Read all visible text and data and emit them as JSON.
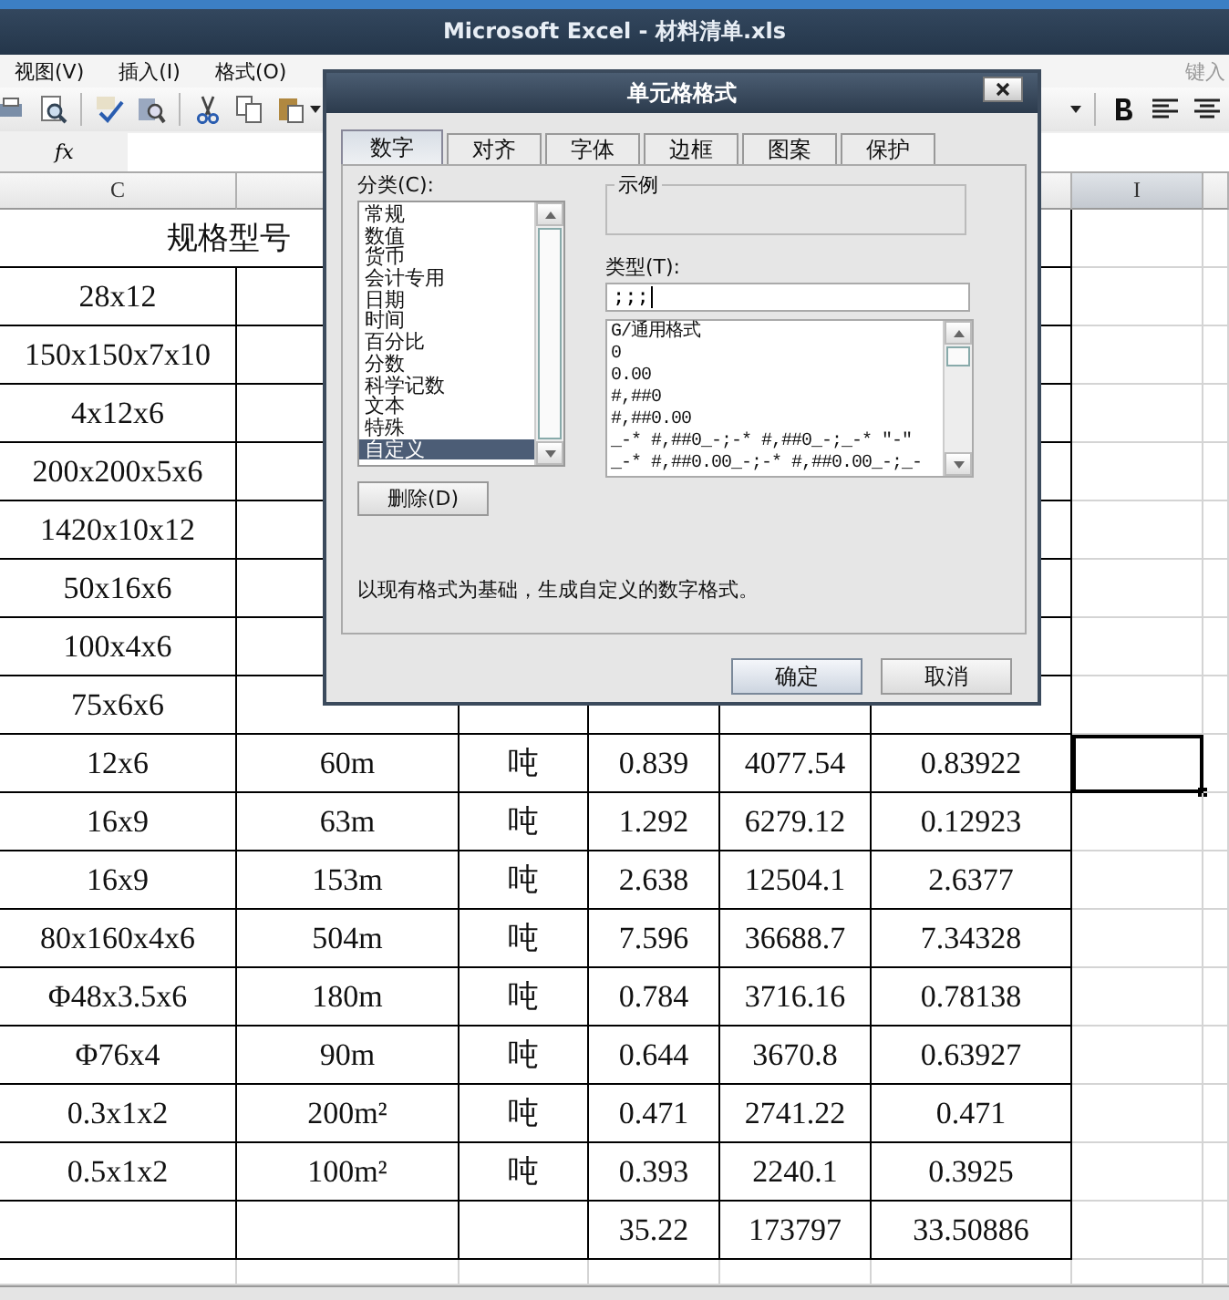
{
  "window": {
    "title": "Microsoft Excel - 材料清单.xls"
  },
  "menu": [
    {
      "label": "视图(V)"
    },
    {
      "label": "插入(I)"
    },
    {
      "label": "格式(O)"
    }
  ],
  "help_search": {
    "placeholder": "键入"
  },
  "formula_bar": {
    "label": "fx"
  },
  "column_headers": [
    {
      "label": "C",
      "selected": false
    },
    {
      "label": "I",
      "selected": true
    }
  ],
  "sheet": {
    "header": "规格型号",
    "rows": [
      {
        "cells": [
          "28x12"
        ],
        "selected": false
      },
      {
        "cells": [
          "150x150x7x10"
        ],
        "selected": false
      },
      {
        "cells": [
          "4x12x6"
        ],
        "selected": false
      },
      {
        "cells": [
          "200x200x5x6"
        ],
        "selected": false
      },
      {
        "cells": [
          "1420x10x12"
        ],
        "selected": false
      },
      {
        "cells": [
          "50x16x6"
        ],
        "selected": false
      },
      {
        "cells": [
          "100x4x6"
        ],
        "selected": false
      },
      {
        "cells": [
          "75x6x6"
        ],
        "selected": false
      },
      {
        "cells": [
          "12x6",
          "60m",
          "吨",
          "0.839",
          "4077.54",
          "0.83922"
        ],
        "selected": true
      },
      {
        "cells": [
          "16x9",
          "63m",
          "吨",
          "1.292",
          "6279.12",
          "0.12923"
        ],
        "selected": false
      },
      {
        "cells": [
          "16x9",
          "153m",
          "吨",
          "2.638",
          "12504.1",
          "2.6377"
        ],
        "selected": false
      },
      {
        "cells": [
          "80x160x4x6",
          "504m",
          "吨",
          "7.596",
          "36688.7",
          "7.34328"
        ],
        "selected": false
      },
      {
        "cells": [
          "Φ48x3.5x6",
          "180m",
          "吨",
          "0.784",
          "3716.16",
          "0.78138"
        ],
        "selected": false
      },
      {
        "cells": [
          "Φ76x4",
          "90m",
          "吨",
          "0.644",
          "3670.8",
          "0.63927"
        ],
        "selected": false
      },
      {
        "cells": [
          "0.3x1x2",
          "200m²",
          "吨",
          "0.471",
          "2741.22",
          "0.471"
        ],
        "selected": false
      },
      {
        "cells": [
          "0.5x1x2",
          "100m²",
          "吨",
          "0.393",
          "2240.1",
          "0.3925"
        ],
        "selected": false
      },
      {
        "cells": [
          null,
          null,
          null,
          "35.22",
          "173797",
          "33.50886"
        ],
        "selected": false
      }
    ]
  },
  "dialog": {
    "title": "单元格格式",
    "tabs": [
      {
        "label": "数字",
        "selected": true
      },
      {
        "label": "对齐",
        "selected": false
      },
      {
        "label": "字体",
        "selected": false
      },
      {
        "label": "边框",
        "selected": false
      },
      {
        "label": "图案",
        "selected": false
      },
      {
        "label": "保护",
        "selected": false
      }
    ],
    "category_label": "分类(C):",
    "categories": [
      {
        "label": "常规",
        "selected": false
      },
      {
        "label": "数值",
        "selected": false
      },
      {
        "label": "货币",
        "selected": false
      },
      {
        "label": "会计专用",
        "selected": false
      },
      {
        "label": "日期",
        "selected": false
      },
      {
        "label": "时间",
        "selected": false
      },
      {
        "label": "百分比",
        "selected": false
      },
      {
        "label": "分数",
        "selected": false
      },
      {
        "label": "科学记数",
        "selected": false
      },
      {
        "label": "文本",
        "selected": false
      },
      {
        "label": "特殊",
        "selected": false
      },
      {
        "label": "自定义",
        "selected": true
      }
    ],
    "sample_label": "示例",
    "type_label": "类型(T):",
    "type_value": ";;;",
    "types": [
      "G/通用格式",
      "0",
      "0.00",
      "#,##0",
      "#,##0.00",
      "_-* #,##0_-;-* #,##0_-;_-* \"-\"",
      "_-* #,##0.00_-;-* #,##0.00_-;_-"
    ],
    "delete_button": "删除(D)",
    "description": "以现有格式为基础，生成自定义的数字格式。",
    "buttons": [
      "确定",
      "取消"
    ]
  }
}
